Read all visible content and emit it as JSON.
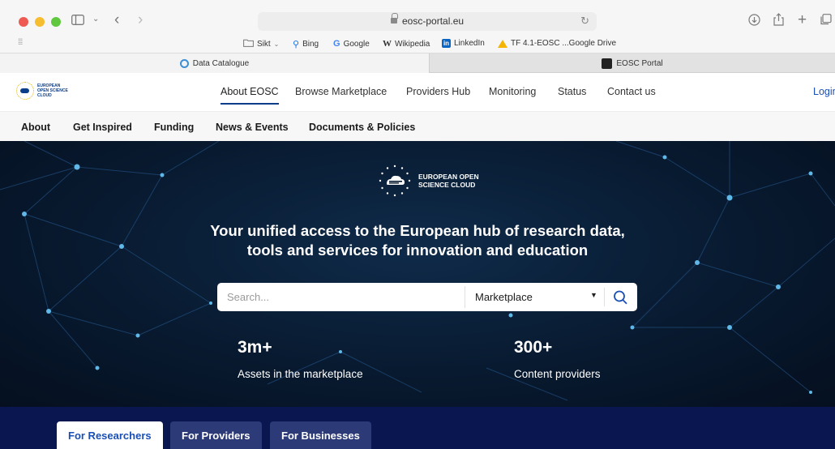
{
  "browser": {
    "url": "eosc-portal.eu",
    "favorites": [
      {
        "label": "Sikt",
        "icon": "folder-icon"
      },
      {
        "label": "Bing",
        "icon": "search-icon"
      },
      {
        "label": "Google",
        "icon": "google-icon"
      },
      {
        "label": "Wikipedia",
        "icon": "wikipedia-icon"
      },
      {
        "label": "LinkedIn",
        "icon": "linkedin-icon"
      },
      {
        "label": "TF 4.1-EOSC ...Google Drive",
        "icon": "google-drive-icon"
      }
    ],
    "tabs": [
      {
        "label": "Data Catalogue",
        "active": true
      },
      {
        "label": "EOSC Portal",
        "active": false
      }
    ]
  },
  "site": {
    "logo_text": "EUROPEAN OPEN SCIENCE CLOUD",
    "main_nav": [
      "About EOSC",
      "Browse Marketplace",
      "Providers Hub",
      "Monitoring",
      "Status",
      "Contact us"
    ],
    "active_nav": "About EOSC",
    "login": "Login",
    "sub_nav": [
      "About",
      "Get Inspired",
      "Funding",
      "News & Events",
      "Documents & Policies"
    ]
  },
  "hero": {
    "logo_text_line1": "EUROPEAN OPEN",
    "logo_text_line2": "SCIENCE CLOUD",
    "title_line1": "Your unified access to the European hub of research data,",
    "title_line2": "tools and services for innovation and education",
    "search_placeholder": "Search...",
    "search_scope": "Marketplace",
    "stats": [
      {
        "value": "3m+",
        "label": "Assets in the marketplace"
      },
      {
        "value": "300+",
        "label": "Content providers"
      }
    ]
  },
  "audience_tabs": [
    {
      "label": "For Researchers",
      "active": true
    },
    {
      "label": "For Providers",
      "active": false
    },
    {
      "label": "For Businesses",
      "active": false
    }
  ],
  "colors": {
    "brand_navy": "#0a1650",
    "link_blue": "#1a4fb6",
    "hero_bg": "#081a30"
  }
}
